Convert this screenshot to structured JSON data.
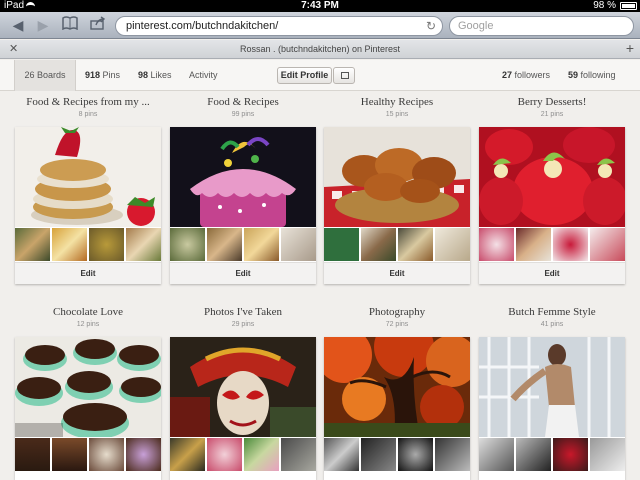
{
  "status": {
    "carrier": "iPad",
    "time": "7:43 PM",
    "battery": "98 %"
  },
  "browser": {
    "url": "pinterest.com/butchndakitchen/",
    "search_placeholder": "Google",
    "tab_title": "Rossan . (butchndakitchen) on Pinterest"
  },
  "profile_nav": {
    "boards_count": "26",
    "boards_label": "Boards",
    "pins_count": "918",
    "pins_label": "Pins",
    "likes_count": "98",
    "likes_label": "Likes",
    "activity_label": "Activity",
    "edit_profile_label": "Edit Profile",
    "followers_count": "27",
    "followers_label": "followers",
    "following_count": "59",
    "following_label": "following"
  },
  "boards": [
    {
      "title": "Food & Recipes from my ...",
      "count": "8 pins",
      "edit_label": "Edit"
    },
    {
      "title": "Food & Recipes",
      "count": "99 pins",
      "edit_label": "Edit"
    },
    {
      "title": "Healthy Recipes",
      "count": "15 pins",
      "edit_label": "Edit"
    },
    {
      "title": "Berry Desserts!",
      "count": "21 pins",
      "edit_label": "Edit"
    },
    {
      "title": "Chocolate Love",
      "count": "12 pins"
    },
    {
      "title": "Photos I've Taken",
      "count": "29 pins"
    },
    {
      "title": "Photography",
      "count": "72 pins"
    },
    {
      "title": "Butch Femme Style",
      "count": "41 pins"
    }
  ],
  "colors": {
    "page_bg": "#f1efec",
    "accent_text": "#3a3a3a"
  }
}
